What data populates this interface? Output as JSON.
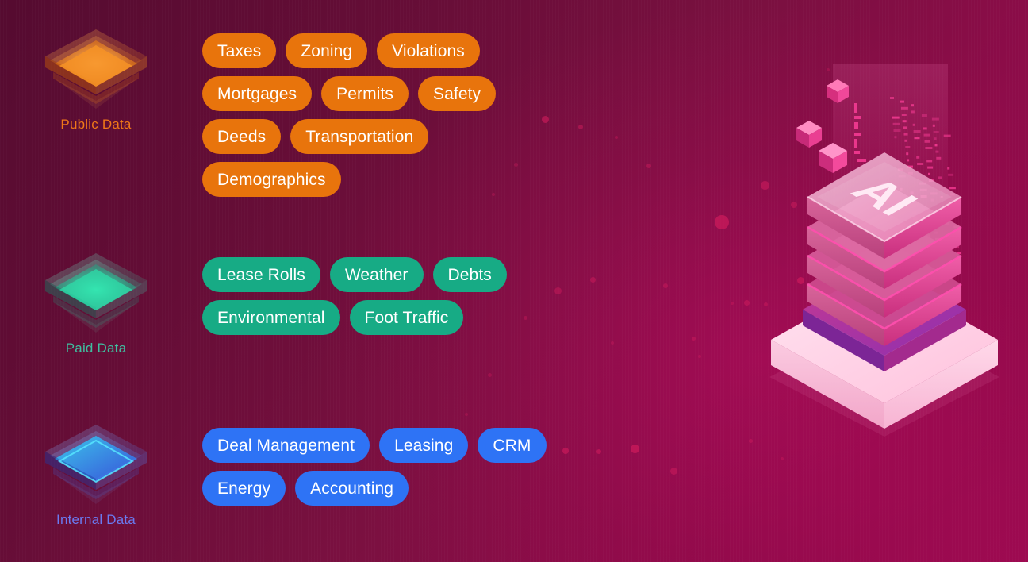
{
  "background": {
    "gradient_from": "#550b30",
    "gradient_mid": "#7a1040",
    "gradient_to": "#97084c",
    "particle_color": "#d81e5f"
  },
  "sections": [
    {
      "id": "public-data",
      "label": "Public Data",
      "label_color": "#f07818",
      "icon": "isometric-layer-box-orange",
      "chip_color": "#e8740c",
      "chip_style": "orange",
      "chips": [
        "Taxes",
        "Zoning",
        "Violations",
        "Mortgages",
        "Permits",
        "Safety",
        "Deeds",
        "Transportation",
        "Demographics"
      ]
    },
    {
      "id": "paid-data",
      "label": "Paid Data",
      "label_color": "#3fbfa0",
      "icon": "isometric-layer-box-teal",
      "chip_color": "#17ab85",
      "chip_style": "teal",
      "chips": [
        "Lease Rolls",
        "Weather",
        "Debts",
        "Environmental",
        "Foot Traffic"
      ]
    },
    {
      "id": "internal-data",
      "label": "Internal Data",
      "label_color": "#6a7af0",
      "icon": "isometric-layer-box-blue",
      "chip_color": "#2e73f5",
      "chip_style": "blue",
      "chips": [
        "Deal Management",
        "Leasing",
        "CRM",
        "Energy",
        "Accounting"
      ]
    }
  ],
  "ai_illustration": {
    "name": "ai-server-stack",
    "top_label": "AI",
    "base_color": "#f7bcd6",
    "layer_color": "#e07ba8",
    "glow_color": "#ff2f9e",
    "cube_color": "#ef3f9e",
    "hologram": "code-panel",
    "cubes": 3,
    "layers": 4
  }
}
